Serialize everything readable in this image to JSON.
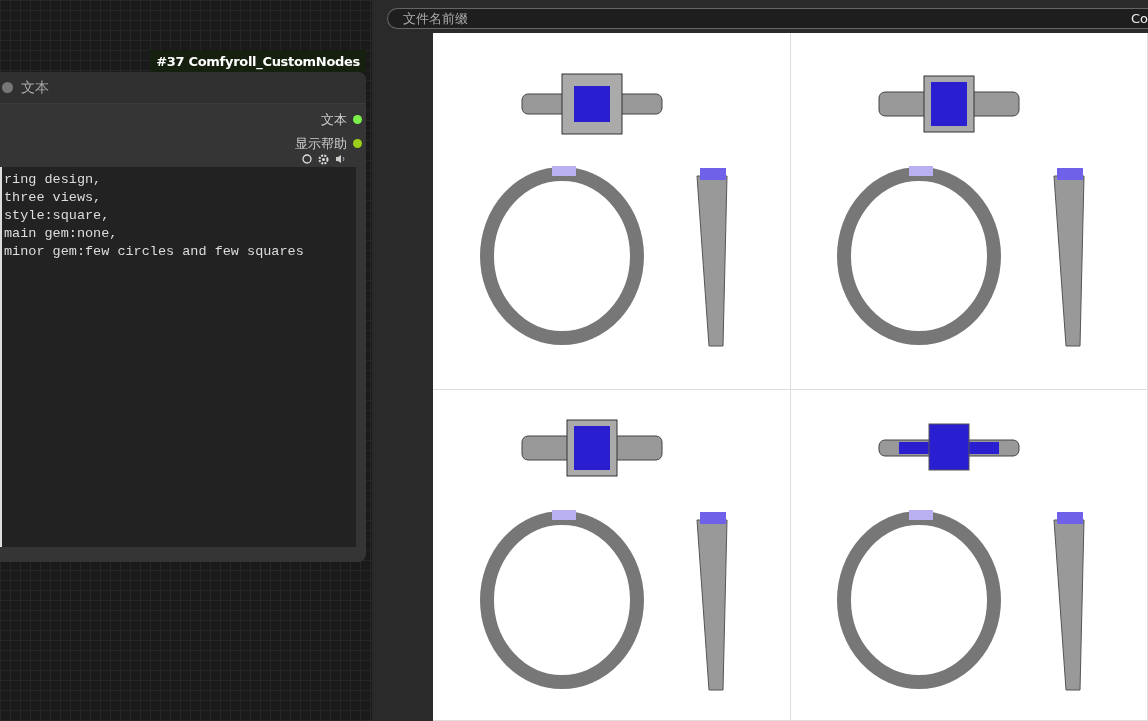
{
  "node": {
    "badge": "#37 Comfyroll_CustomNodes",
    "title": "文本",
    "outputs": [
      {
        "label": "文本",
        "color": "#7ef04a"
      },
      {
        "label": "显示帮助",
        "color": "#9ccf18"
      }
    ],
    "text": "ring design,\nthree views,\nstyle:square,\nmain gem:none,\nminor gem:few circles and few squares"
  },
  "preview": {
    "field": {
      "label": "文件名前缀",
      "value": "Co"
    },
    "images": [
      {
        "kind": "halo"
      },
      {
        "kind": "cluster"
      },
      {
        "kind": "cluster"
      },
      {
        "kind": "baguette"
      }
    ]
  }
}
